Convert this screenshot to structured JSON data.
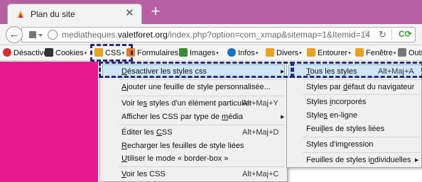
{
  "browser": {
    "tab_title": "Plan du site",
    "new_tab_symbol": "+",
    "close_symbol": "✕",
    "url_prefix": "mediatheques.",
    "url_host": "valetforet.org",
    "url_path": "/index.php?option=com_xmap&sitemap=1&Itemid=14"
  },
  "devbar": {
    "items": [
      {
        "label": "Désactiver",
        "icon": "disable-icon",
        "color": "#d13232"
      },
      {
        "label": "Cookies",
        "icon": "cookie-icon",
        "color": "#333333"
      },
      {
        "label": "CSS",
        "icon": "pencil-icon",
        "color": "#e8a320"
      },
      {
        "label": "Formulaires",
        "icon": "form-icon",
        "color": "#e07b2b"
      },
      {
        "label": "Images",
        "icon": "image-icon",
        "color": "#3a8a3a"
      },
      {
        "label": "Infos",
        "icon": "info-icon",
        "color": "#1a6fc4"
      },
      {
        "label": "Divers",
        "icon": "divers-icon",
        "color": "#e8a320"
      },
      {
        "label": "Entourer",
        "icon": "outline-icon",
        "color": "#e8a320"
      },
      {
        "label": "Fenêtre",
        "icon": "window-icon",
        "color": "#e8a320"
      },
      {
        "label": "Outils",
        "icon": "tools-icon",
        "color": "#777777"
      }
    ]
  },
  "css_menu": {
    "items": [
      {
        "label": "Désactiver les styles css",
        "shortcut": "",
        "submenu": true
      },
      {
        "label": "Ajouter une feuille de style personnalisée...",
        "shortcut": "",
        "submenu": false
      },
      {
        "label": "Voir les styles d'un élément particulier",
        "shortcut": "Alt+Maj+Y",
        "submenu": false
      },
      {
        "label": "Afficher les CSS par type de média",
        "shortcut": "",
        "submenu": true
      },
      {
        "label": "Éditer les CSS",
        "shortcut": "Alt+Maj+D",
        "submenu": false
      },
      {
        "label": "Recharger les feuilles de style liées",
        "shortcut": "",
        "submenu": false
      },
      {
        "label": "Utiliser le mode « border-box »",
        "shortcut": "",
        "submenu": false
      },
      {
        "label": "Voir les CSS",
        "shortcut": "Alt+Maj+C",
        "submenu": false
      }
    ]
  },
  "submenu": {
    "items": [
      {
        "label": "Tous les styles",
        "shortcut": "Alt+Maj+A"
      },
      {
        "label": "Styles par défaut du navigateur",
        "shortcut": ""
      },
      {
        "label": "Styles incorporés",
        "shortcut": ""
      },
      {
        "label": "Styles en-ligne",
        "shortcut": ""
      },
      {
        "label": "Feuilles de styles liées",
        "shortcut": ""
      },
      {
        "label": "Styles d'impression",
        "shortcut": ""
      },
      {
        "label": "Feuilles de styles individuelles",
        "shortcut": ""
      }
    ]
  },
  "colors": {
    "tabstrip": "#b75fa3",
    "page_accent": "#e4198d",
    "highlight": "#d0e6f7",
    "annotation_dash": "#2a2a7a"
  }
}
